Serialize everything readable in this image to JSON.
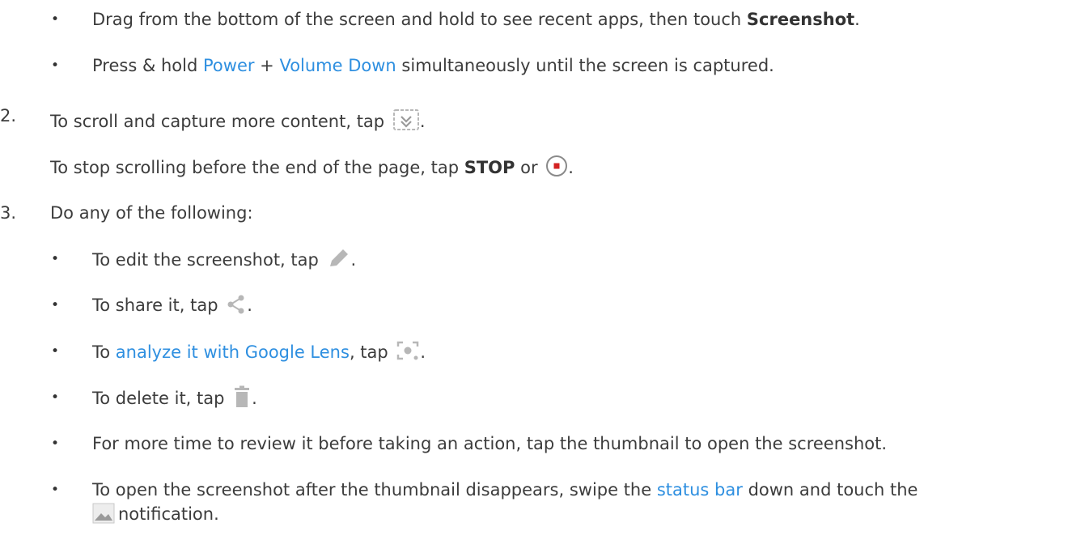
{
  "icons": [
    "scroll-capture-icon",
    "stop-record-icon",
    "edit-pencil-icon",
    "share-icon",
    "google-lens-icon",
    "trash-icon",
    "image-notification-icon"
  ],
  "colors": {
    "text": "#3c3c3c",
    "link": "#2e8fe0",
    "icon_gray": "#b7b7b7",
    "stop_red": "#d32222"
  },
  "bullet": "•",
  "top_items": [
    {
      "pre": "Drag from the bottom of the screen and hold to see recent apps, then touch ",
      "bold": "Screenshot",
      "post": "."
    },
    {
      "pre": "Press & hold ",
      "link1": "Power",
      "mid": " + ",
      "link2": "Volume Down",
      "post": " simultaneously until the screen is captured."
    }
  ],
  "step2": {
    "number": "2.",
    "text": "To scroll and capture more content, tap ",
    "end": ".",
    "sub_pre": "To stop scrolling before the end of the page, tap ",
    "sub_bold": "STOP",
    "sub_mid": " or ",
    "sub_end": "."
  },
  "step3": {
    "number": "3.",
    "text": "Do any of the following:",
    "items": [
      {
        "pre": "To edit the screenshot, tap ",
        "post": "."
      },
      {
        "pre": "To share it, tap ",
        "post": "."
      },
      {
        "pre": "To ",
        "link": "analyze it with Google Lens",
        "mid": ", tap ",
        "post": "."
      },
      {
        "pre": "To delete it, tap ",
        "post": "."
      },
      {
        "text": "For more time to review it before taking an action, tap the thumbnail to open the screenshot."
      },
      {
        "pre": "To open the screenshot after the thumbnail disappears, swipe the ",
        "link": "status bar",
        "post": " down and touch the",
        "line2": "notification."
      }
    ]
  }
}
